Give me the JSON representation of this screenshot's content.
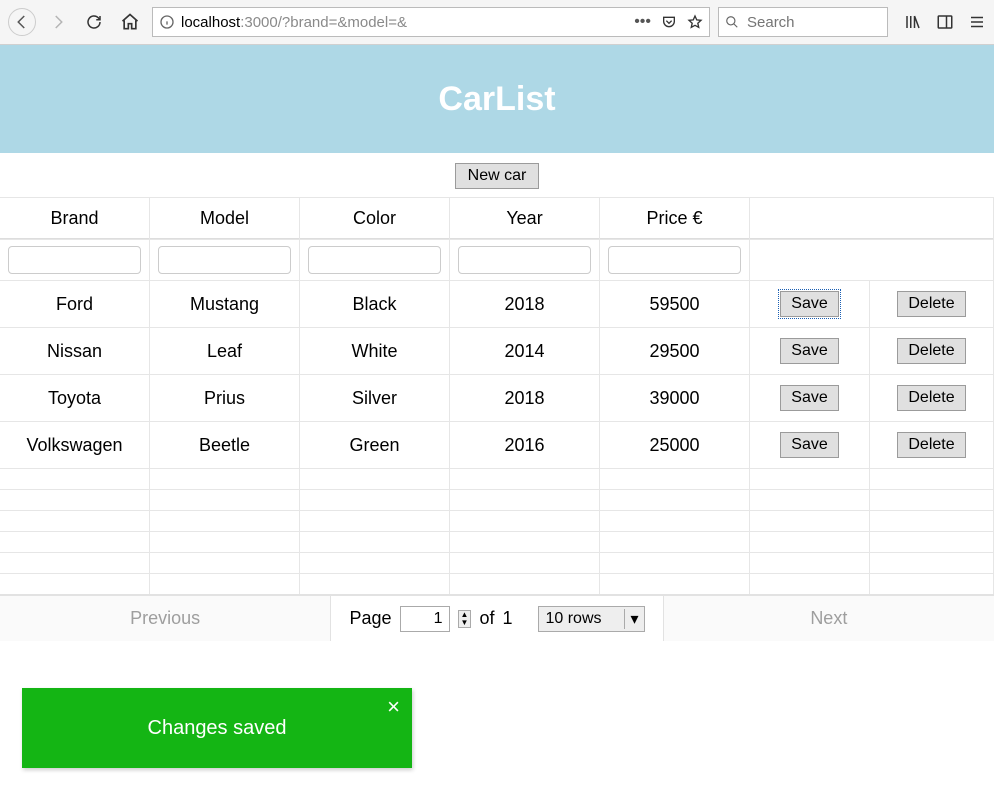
{
  "browser": {
    "url_host": "localhost",
    "url_path": ":3000/?brand=&model=&",
    "search_placeholder": "Search"
  },
  "header": {
    "title": "CarList"
  },
  "toolbar": {
    "new_car": "New car"
  },
  "table": {
    "columns": [
      "Brand",
      "Model",
      "Color",
      "Year",
      "Price €"
    ],
    "actions": {
      "save": "Save",
      "delete": "Delete"
    },
    "rows": [
      {
        "brand": "Ford",
        "model": "Mustang",
        "color": "Black",
        "year": "2018",
        "price": "59500",
        "focused": true
      },
      {
        "brand": "Nissan",
        "model": "Leaf",
        "color": "White",
        "year": "2014",
        "price": "29500"
      },
      {
        "brand": "Toyota",
        "model": "Prius",
        "color": "Silver",
        "year": "2018",
        "price": "39000"
      },
      {
        "brand": "Volkswagen",
        "model": "Beetle",
        "color": "Green",
        "year": "2016",
        "price": "25000"
      }
    ],
    "empty_rows": 6
  },
  "pagination": {
    "previous": "Previous",
    "next": "Next",
    "page_label": "Page",
    "of_label": "of",
    "current_page": "1",
    "total_pages": "1",
    "rows_label": "10 rows"
  },
  "toast": {
    "message": "Changes saved"
  }
}
